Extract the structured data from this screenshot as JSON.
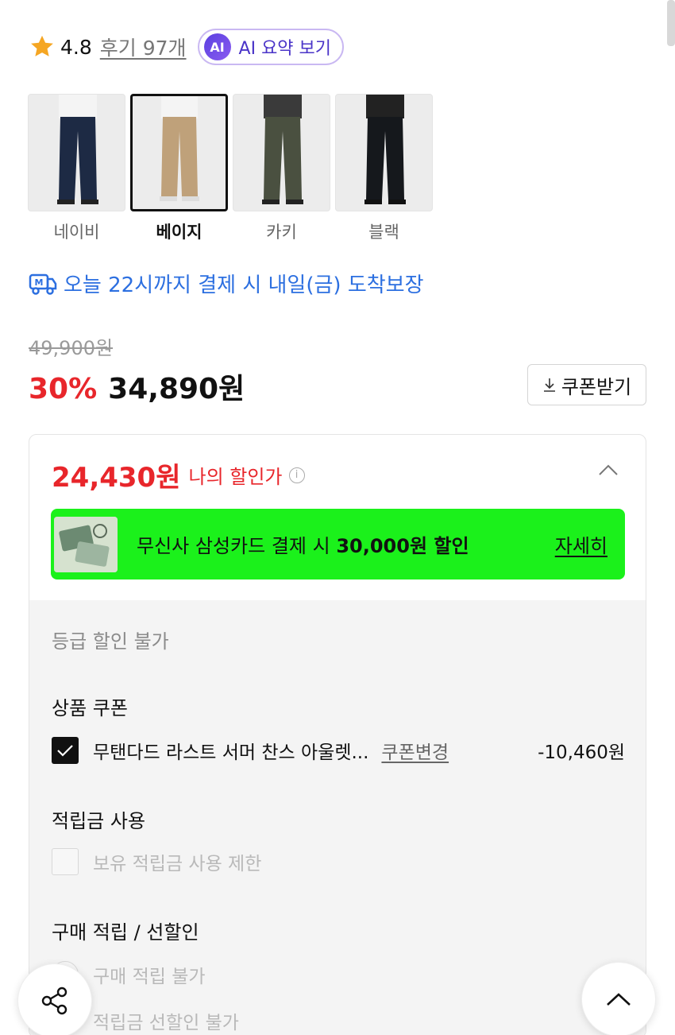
{
  "rating": {
    "score": "4.8",
    "reviews": "후기 97개",
    "ai_badge": "AI",
    "ai_label": "AI 요약 보기"
  },
  "colors": [
    {
      "name": "네이비",
      "selected": false,
      "tone": "#1d2a44"
    },
    {
      "name": "베이지",
      "selected": true,
      "tone": "#bfa17a"
    },
    {
      "name": "카키",
      "selected": false,
      "tone": "#4a5040"
    },
    {
      "name": "블랙",
      "selected": false,
      "tone": "#15181c"
    }
  ],
  "delivery": {
    "text": "오늘 22시까지 결제 시 내일(금) 도착보장"
  },
  "price": {
    "original": "49,900원",
    "discount": "30%",
    "current": "34,890원",
    "coupon_button": "쿠폰받기"
  },
  "benefit": {
    "my_price": "24,430원",
    "my_price_label": "나의 할인가",
    "banner": {
      "prefix": "무신사 삼성카드 결제 시 ",
      "amount": "30,000원 할인",
      "link": "자세히"
    },
    "grade": "등급 할인 불가",
    "product_coupon": {
      "title": "상품 쿠폰",
      "name": "무탠다드 라스트 서머 찬스 아울렛...",
      "change": "쿠폰변경",
      "amount": "-10,460원"
    },
    "points": {
      "title": "적립금 사용",
      "option": "보유 적립금 사용 제한"
    },
    "purchase": {
      "title": "구매 적립 / 선할인",
      "option1": "구매 적립 불가",
      "option2": "적립금 선할인 불가"
    }
  },
  "accent_colors": {
    "red": "#e8262b",
    "blue": "#2c6fe0",
    "banner_green": "#1bf11b"
  }
}
